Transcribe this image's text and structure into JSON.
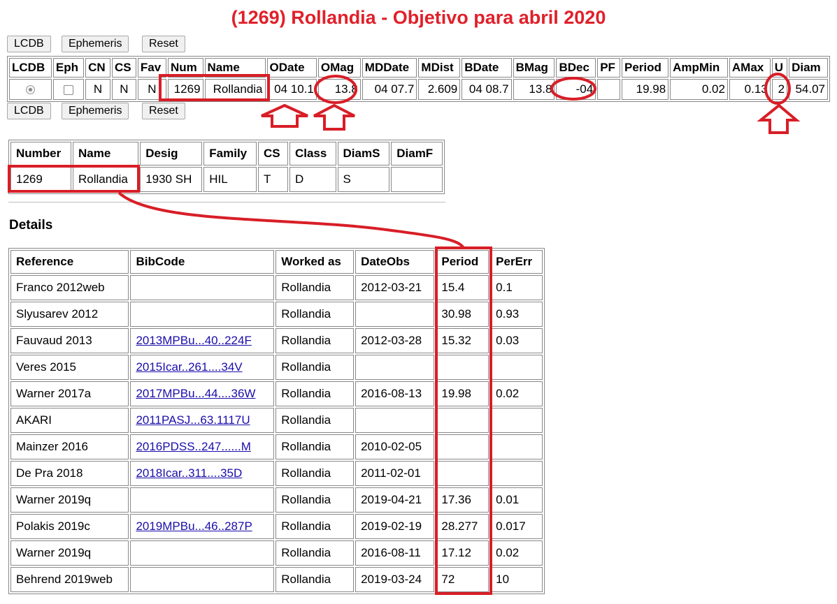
{
  "page_title": "(1269) Rollandia - Objetivo para abril 2020",
  "toolbar_top": {
    "lcdb": "LCDB",
    "ephemeris": "Ephemeris",
    "reset": "Reset"
  },
  "toolbar_bottom": {
    "lcdb": "LCDB",
    "ephemeris": "Ephemeris",
    "reset": "Reset"
  },
  "main_table": {
    "headers": [
      "LCDB",
      "Eph",
      "CN",
      "CS",
      "Fav",
      "Num",
      "Name",
      "ODate",
      "OMag",
      "MDDate",
      "MDist",
      "BDate",
      "BMag",
      "BDec",
      "PF",
      "Period",
      "AmpMin",
      "AMax",
      "U",
      "Diam"
    ],
    "row": {
      "cn": "N",
      "cs": "N",
      "fav": "N",
      "num": "1269",
      "name": "Rollandia",
      "odate": "04 10.1",
      "omag": "13.8",
      "mddate": "04 07.7",
      "mdist": "2.609",
      "bdate": "04 08.7",
      "bmag": "13.8",
      "bdec": "-04",
      "pf": "",
      "period": "19.98",
      "ampmin": "0.02",
      "amax": "0.13",
      "u": "2",
      "diam": "54.07"
    }
  },
  "info_table": {
    "headers": [
      "Number",
      "Name",
      "Desig",
      "Family",
      "CS",
      "Class",
      "DiamS",
      "DiamF"
    ],
    "row": [
      "1269",
      "Rollandia",
      "1930 SH",
      "HIL",
      "T",
      "D",
      "S",
      ""
    ]
  },
  "details": {
    "title": "Details",
    "headers": [
      "Reference",
      "BibCode",
      "Worked as",
      "DateObs",
      "Period",
      "PerErr"
    ],
    "rows": [
      [
        "Franco 2012web",
        "",
        "Rollandia",
        "2012-03-21",
        "15.4",
        "0.1"
      ],
      [
        "Slyusarev 2012",
        "",
        "Rollandia",
        "",
        "30.98",
        "0.93"
      ],
      [
        "Fauvaud 2013",
        "2013MPBu...40..224F",
        "Rollandia",
        "2012-03-28",
        "15.32",
        "0.03"
      ],
      [
        "Veres 2015",
        "2015Icar..261....34V",
        "Rollandia",
        "",
        "",
        ""
      ],
      [
        "Warner 2017a",
        "2017MPBu...44....36W",
        "Rollandia",
        "2016-08-13",
        "19.98",
        "0.02"
      ],
      [
        "AKARI",
        "2011PASJ...63.1117U",
        "Rollandia",
        "",
        "",
        ""
      ],
      [
        "Mainzer 2016",
        "2016PDSS..247......M",
        "Rollandia",
        "2010-02-05",
        "",
        ""
      ],
      [
        "De Pra 2018",
        "2018Icar..311....35D",
        "Rollandia",
        "2011-02-01",
        "",
        ""
      ],
      [
        "Warner 2019q",
        "",
        "Rollandia",
        "2019-04-21",
        "17.36",
        "0.01"
      ],
      [
        "Polakis 2019c",
        "2019MPBu...46..287P",
        "Rollandia",
        "2019-02-19",
        "28.277",
        "0.017"
      ],
      [
        "Warner 2019q",
        "",
        "Rollandia",
        "2016-08-11",
        "17.12",
        "0.02"
      ],
      [
        "Behrend 2019web",
        "",
        "Rollandia",
        "2019-03-24",
        "72",
        "10"
      ]
    ]
  },
  "colors": {
    "title": "#e0202a",
    "annotation": "#d81e27",
    "link": "#1a0dab"
  }
}
